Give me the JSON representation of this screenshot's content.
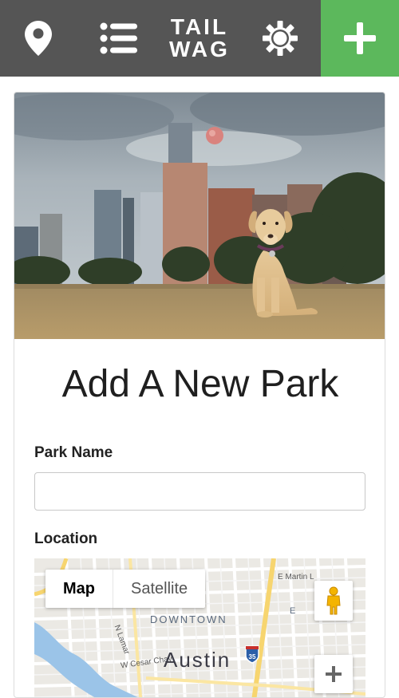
{
  "nav": {
    "logo_line1": "TAIL",
    "logo_line2": "WAG",
    "pin_icon": "map-pin-icon",
    "list_icon": "list-icon",
    "gear_icon": "gear-icon",
    "add_icon": "plus-icon",
    "bar_color": "#555555",
    "add_color": "#5cb85c"
  },
  "form": {
    "title": "Add A New Park",
    "park_name_label": "Park Name",
    "park_name_value": "",
    "location_label": "Location"
  },
  "map": {
    "type_map": "Map",
    "type_satellite": "Satellite",
    "label_downtown": "DOWNTOWN",
    "label_city": "Austin",
    "label_street_mlk": "E Martin L",
    "label_street_lamar": "N Lamar",
    "label_street_cesar": "W Cesar Chav",
    "label_east": "E",
    "highway_shield": "35",
    "pegman_icon": "pegman-icon",
    "zoom_in_icon": "plus-icon"
  }
}
